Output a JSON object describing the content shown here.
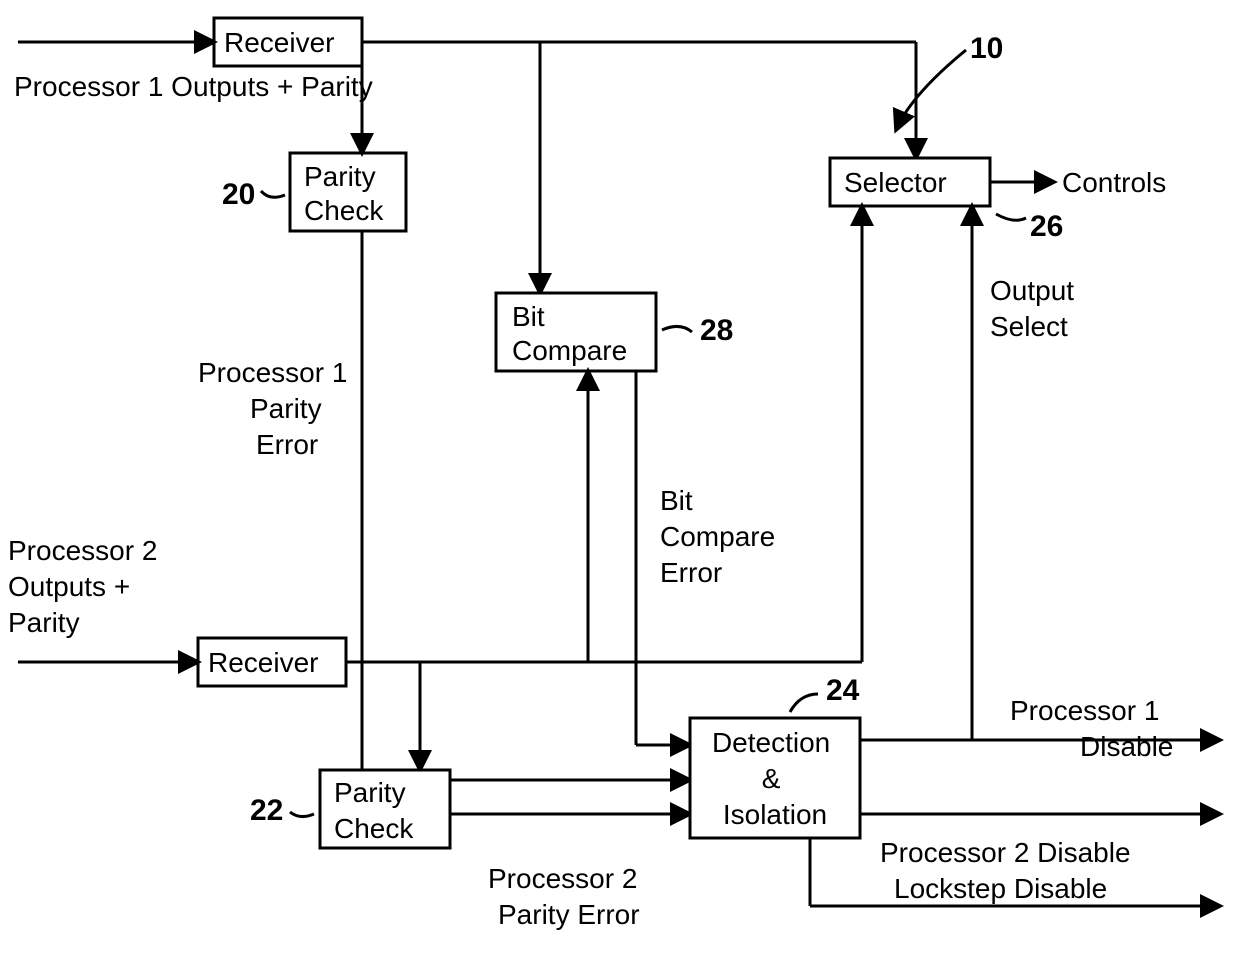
{
  "boxes": {
    "receiver1": "Receiver",
    "receiver2": "Receiver",
    "parity_check1": "Parity\nCheck",
    "parity_check2": "Parity\nCheck",
    "bit_compare": "Bit\nCompare",
    "selector": "Selector",
    "detection_isolation": "Detection\n&\nIsolation"
  },
  "labels": {
    "input1": "Processor 1\nOutputs +\nParity",
    "input2": "Processor 2\nOutputs +\nParity",
    "controls": "Controls",
    "output_select": "Output\nSelect",
    "p1_parity_error": "Processor 1\nParity\nError",
    "p2_parity_error": "Processor 2\nParity Error",
    "bit_compare_error": "Bit\nCompare\nError",
    "p1_disable": "Processor 1\nDisable",
    "p2_disable": "Processor 2 Disable",
    "lockstep_disable": "Lockstep Disable"
  },
  "refs": {
    "r10": "10",
    "r20": "20",
    "r22": "22",
    "r24": "24",
    "r26": "26",
    "r28": "28"
  }
}
